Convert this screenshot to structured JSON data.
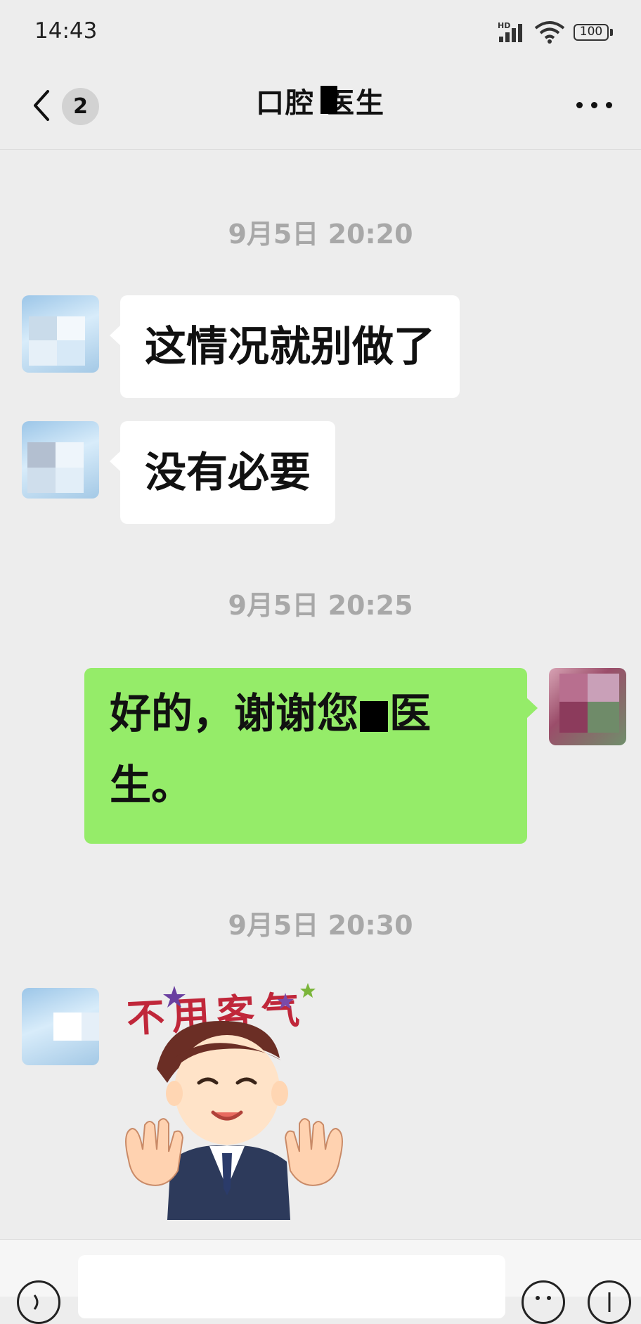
{
  "status_bar": {
    "time": "14:43",
    "network_label": "HD",
    "battery": "100"
  },
  "nav": {
    "unread_count": "2",
    "title": "口腔 医生"
  },
  "messages": [
    {
      "type": "timestamp",
      "text": "9月5日 20:20"
    },
    {
      "type": "received",
      "text": "这情况就别做了"
    },
    {
      "type": "received",
      "text": "没有必要"
    },
    {
      "type": "timestamp",
      "text": "9月5日 20:25"
    },
    {
      "type": "sent",
      "text_a": "好的，谢谢您",
      "text_b": "医",
      "text_c": "生。"
    },
    {
      "type": "timestamp",
      "text": "9月5日 20:30"
    },
    {
      "type": "sticker",
      "caption": "不用客气"
    }
  ],
  "icons": [
    "back-arrow-icon",
    "more-icon",
    "signal-icon",
    "wifi-icon",
    "battery-icon",
    "voice-icon",
    "emoji-icon",
    "plus-icon"
  ],
  "colors": {
    "background": "#ededed",
    "sent_bubble": "#95ec69",
    "received_bubble": "#ffffff",
    "timestamp": "#a8a8a8"
  }
}
